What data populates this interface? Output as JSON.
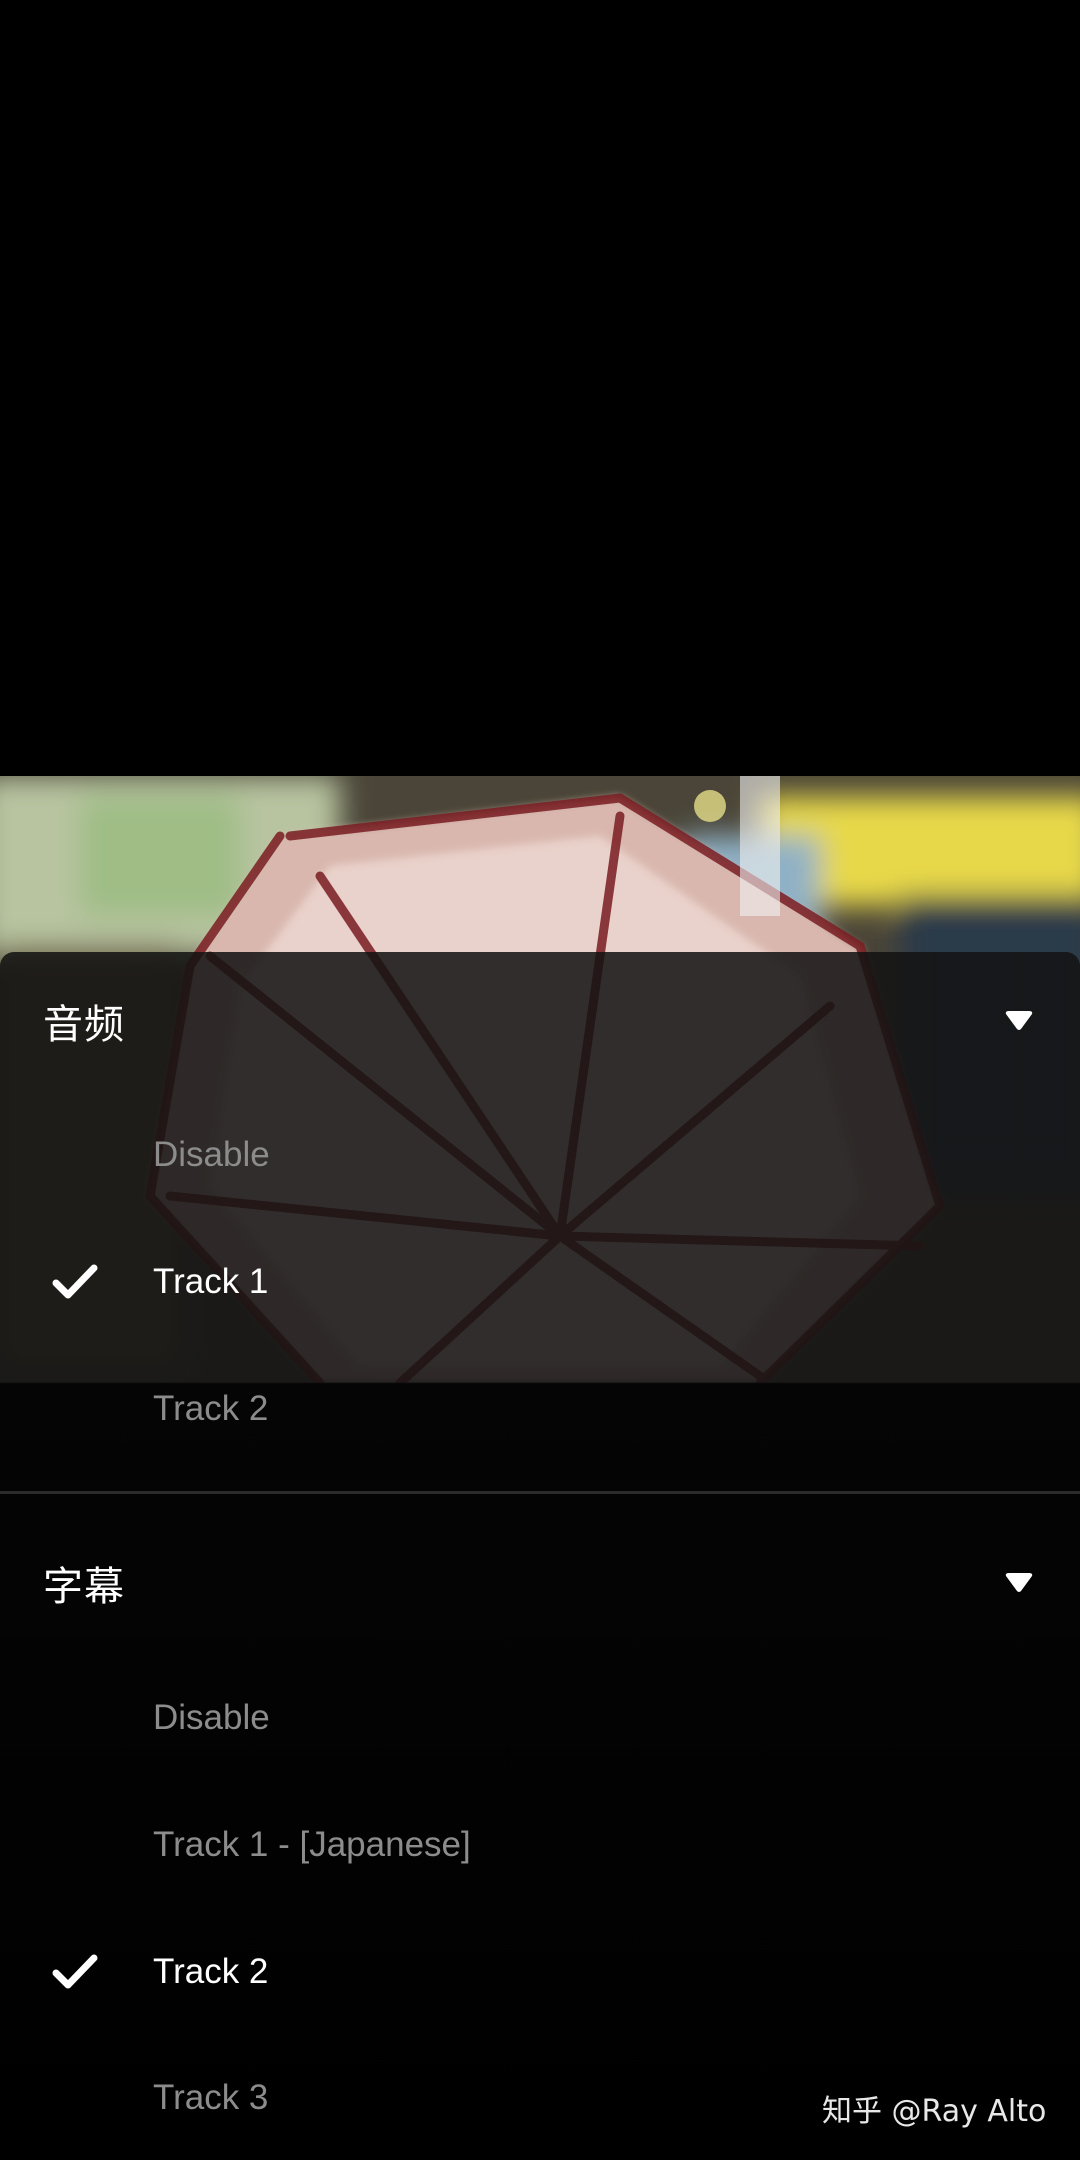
{
  "audio_section": {
    "title": "音频",
    "expand_icon": "caret-down-icon",
    "options": [
      {
        "label": "Disable",
        "selected": false
      },
      {
        "label": "Track 1",
        "selected": true
      },
      {
        "label": "Track 2",
        "selected": false
      }
    ]
  },
  "subtitle_section": {
    "title": "字幕",
    "expand_icon": "caret-down-icon",
    "options": [
      {
        "label": "Disable",
        "selected": false
      },
      {
        "label": "Track 1 - [Japanese]",
        "selected": false
      },
      {
        "label": "Track 2",
        "selected": true
      },
      {
        "label": "Track 3",
        "selected": false
      }
    ]
  },
  "selected_icon": "checkmark-icon",
  "watermark": "知乎 @Ray Alto",
  "colors": {
    "background": "#000000",
    "sheet": "#121212",
    "text_selected": "#ffffff",
    "text_unselected": "#8c8c8c",
    "divider": "#2b2b2b"
  }
}
